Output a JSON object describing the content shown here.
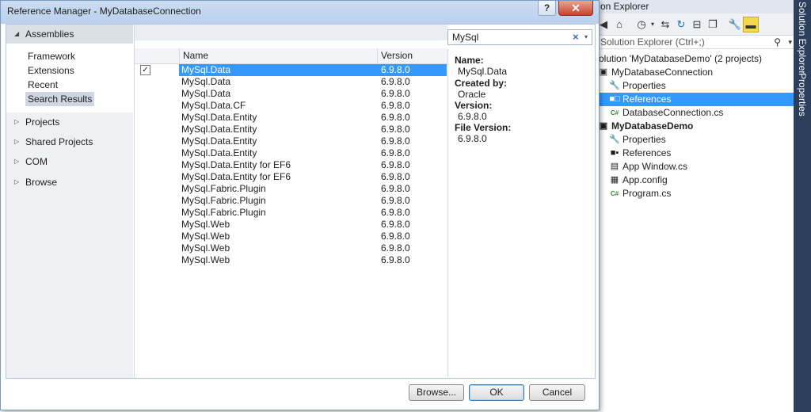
{
  "dialog": {
    "title": "Reference Manager - MyDatabaseConnection",
    "help_label": "?",
    "close_label": "✕",
    "nav": {
      "assemblies_label": "Assemblies",
      "assemblies_sub": [
        "Framework",
        "Extensions",
        "Recent",
        "Search Results"
      ],
      "projects_label": "Projects",
      "shared_projects_label": "Shared Projects",
      "com_label": "COM",
      "browse_label": "Browse"
    },
    "search": {
      "value": "MySql",
      "clear_icon": "×",
      "dropdown_icon": "▾"
    },
    "columns": {
      "name": "Name",
      "version": "Version"
    },
    "rows": [
      {
        "name": "MySql.Data",
        "version": "6.9.8.0",
        "checked": true,
        "selected": true
      },
      {
        "name": "MySql.Data",
        "version": "6.9.8.0"
      },
      {
        "name": "MySql.Data",
        "version": "6.9.8.0"
      },
      {
        "name": "MySql.Data.CF",
        "version": "6.9.8.0"
      },
      {
        "name": "MySql.Data.Entity",
        "version": "6.9.8.0"
      },
      {
        "name": "MySql.Data.Entity",
        "version": "6.9.8.0"
      },
      {
        "name": "MySql.Data.Entity",
        "version": "6.9.8.0"
      },
      {
        "name": "MySql.Data.Entity",
        "version": "6.9.8.0"
      },
      {
        "name": "MySql.Data.Entity for EF6",
        "version": "6.9.8.0"
      },
      {
        "name": "MySql.Data.Entity for EF6",
        "version": "6.9.8.0"
      },
      {
        "name": "MySql.Fabric.Plugin",
        "version": "6.9.8.0"
      },
      {
        "name": "MySql.Fabric.Plugin",
        "version": "6.9.8.0"
      },
      {
        "name": "MySql.Fabric.Plugin",
        "version": "6.9.8.0"
      },
      {
        "name": "MySql.Web",
        "version": "6.9.8.0"
      },
      {
        "name": "MySql.Web",
        "version": "6.9.8.0"
      },
      {
        "name": "MySql.Web",
        "version": "6.9.8.0"
      },
      {
        "name": "MySql.Web",
        "version": "6.9.8.0"
      }
    ],
    "details": {
      "name_label": "Name:",
      "name_value": "MySql.Data",
      "created_label": "Created by:",
      "created_value": "Oracle",
      "version_label": "Version:",
      "version_value": "6.9.8.0",
      "file_version_label": "File Version:",
      "file_version_value": "6.9.8.0"
    },
    "buttons": {
      "browse": "Browse...",
      "ok": "OK",
      "cancel": "Cancel"
    }
  },
  "solution_explorer": {
    "title": "on Explorer",
    "search_placeholder": "Solution Explorer (Ctrl+;)",
    "side_tabs": [
      "Solution Explorer",
      "Properties"
    ],
    "tree": [
      {
        "text": "olution 'MyDatabaseDemo' (2 projects)",
        "icon": "",
        "indent": 0,
        "bold": false
      },
      {
        "text": "MyDatabaseConnection",
        "icon": "▣",
        "indent": 1,
        "bold": false
      },
      {
        "text": "Properties",
        "icon": "🔧",
        "indent": 2,
        "bold": false
      },
      {
        "text": "References",
        "icon": "■□",
        "indent": 2,
        "bold": false,
        "selected": true
      },
      {
        "text": "DatabaseConnection.cs",
        "icon": "C#",
        "indent": 2,
        "bold": false
      },
      {
        "text": "MyDatabaseDemo",
        "icon": "▣",
        "indent": 1,
        "bold": true
      },
      {
        "text": "Properties",
        "icon": "🔧",
        "indent": 2,
        "bold": false
      },
      {
        "text": "References",
        "icon": "■▪",
        "indent": 2,
        "bold": false
      },
      {
        "text": "App Window.cs",
        "icon": "▤",
        "indent": 2,
        "bold": false
      },
      {
        "text": "App.config",
        "icon": "▦",
        "indent": 2,
        "bold": false
      },
      {
        "text": "Program.cs",
        "icon": "C#",
        "indent": 2,
        "bold": false
      }
    ]
  }
}
